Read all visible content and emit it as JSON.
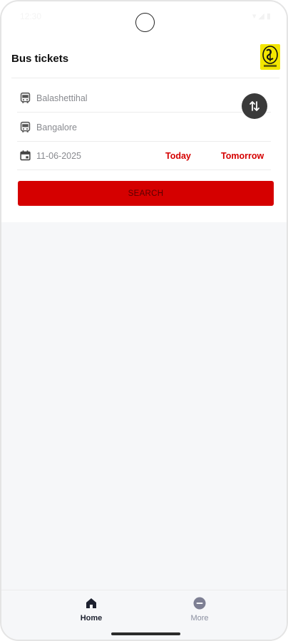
{
  "status_bar": {
    "time": "12:30",
    "icons": "▾ ◢ ▮"
  },
  "header": {
    "title": "Bus tickets"
  },
  "search_form": {
    "from_value": "Balashettihal",
    "to_value": "Bangalore",
    "date_value": "11-06-2025",
    "today_label": "Today",
    "tomorrow_label": "Tomorrow",
    "search_label": "SEARCH"
  },
  "bottom_nav": {
    "items": [
      {
        "label": "Home",
        "icon": "home-icon",
        "active": true
      },
      {
        "label": "More",
        "icon": "more-icon",
        "active": false
      }
    ]
  },
  "colors": {
    "accent": "#d50000",
    "logo_yellow": "#f3e600",
    "swap_bg": "#3a3a3a",
    "page_bg": "#f6f7f9"
  }
}
